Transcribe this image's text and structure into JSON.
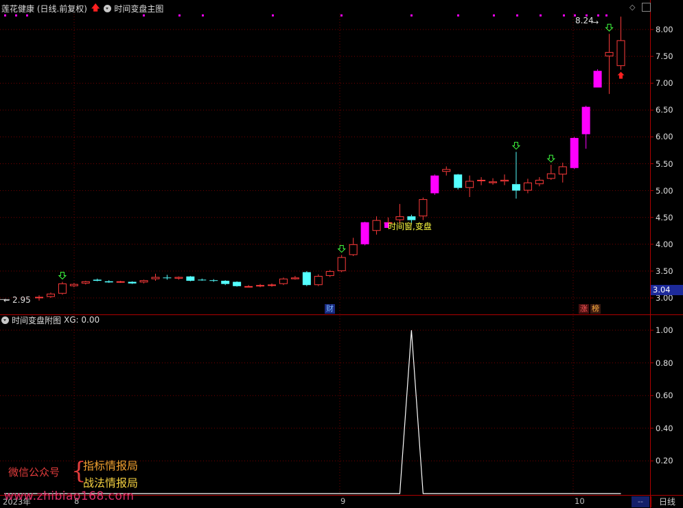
{
  "main_header": {
    "title": "莲花健康 (日线.前复权)",
    "indicator": "时间变盘主图"
  },
  "sub_header": {
    "indicator": "时间变盘附图",
    "value_text": "XG: 0.00"
  },
  "price_axis_labels": [
    "8.00",
    "7.50",
    "7.00",
    "6.50",
    "6.00",
    "5.50",
    "5.00",
    "4.50",
    "4.00",
    "3.50",
    "3.00"
  ],
  "sub_axis_labels": [
    "1.00",
    "0.80",
    "0.60",
    "0.40",
    "0.20"
  ],
  "current_price_tag": "3.04",
  "annotations": {
    "high": "8.24",
    "low": "2.95",
    "signal": "时间窗,变盘",
    "cai": "财",
    "zhang": "涨",
    "bang": "榜"
  },
  "x_labels": {
    "year": "2023年",
    "m8": "8",
    "m9": "9",
    "m10": "10"
  },
  "bottom_controls": {
    "dash": "--",
    "period": "日线"
  },
  "watermark": {
    "wechat": "微信公众号",
    "brace": "{",
    "line1": "指标情报局",
    "line2": "战法情报局",
    "url": "www.zhibiao168.com"
  },
  "colors": {
    "up": "#ff3b3b",
    "down_cyan": "#54ffff",
    "strong_up": "#ff00ff",
    "grid": "#7a0000",
    "axis_border": "#b00000",
    "dots": "#ff00ff",
    "signal_text": "#ffff40",
    "sub_line": "#ffffff"
  },
  "chart_data": {
    "type": "candlestick",
    "series": [
      {
        "o": 3.0,
        "h": 3.05,
        "l": 2.95,
        "c": 3.02,
        "k": "up"
      },
      {
        "o": 3.02,
        "h": 3.1,
        "l": 3.0,
        "c": 3.08,
        "k": "up"
      },
      {
        "o": 3.08,
        "h": 3.3,
        "l": 3.06,
        "c": 3.27,
        "k": "up"
      },
      {
        "o": 3.22,
        "h": 3.28,
        "l": 3.2,
        "c": 3.26,
        "k": "up"
      },
      {
        "o": 3.27,
        "h": 3.32,
        "l": 3.25,
        "c": 3.31,
        "k": "up"
      },
      {
        "o": 3.32,
        "h": 3.36,
        "l": 3.31,
        "c": 3.34,
        "k": "dn"
      },
      {
        "o": 3.31,
        "h": 3.33,
        "l": 3.28,
        "c": 3.29,
        "k": "dn"
      },
      {
        "o": 3.29,
        "h": 3.32,
        "l": 3.28,
        "c": 3.31,
        "k": "up"
      },
      {
        "o": 3.3,
        "h": 3.31,
        "l": 3.26,
        "c": 3.27,
        "k": "dn"
      },
      {
        "o": 3.29,
        "h": 3.34,
        "l": 3.27,
        "c": 3.33,
        "k": "up"
      },
      {
        "o": 3.35,
        "h": 3.45,
        "l": 3.32,
        "c": 3.39,
        "k": "up"
      },
      {
        "o": 3.38,
        "h": 3.43,
        "l": 3.34,
        "c": 3.37,
        "k": "dn"
      },
      {
        "o": 3.36,
        "h": 3.4,
        "l": 3.34,
        "c": 3.39,
        "k": "up"
      },
      {
        "o": 3.4,
        "h": 3.41,
        "l": 3.31,
        "c": 3.32,
        "k": "dn"
      },
      {
        "o": 3.34,
        "h": 3.36,
        "l": 3.32,
        "c": 3.33,
        "k": "dn"
      },
      {
        "o": 3.33,
        "h": 3.35,
        "l": 3.3,
        "c": 3.32,
        "k": "dn"
      },
      {
        "o": 3.32,
        "h": 3.33,
        "l": 3.24,
        "c": 3.26,
        "k": "dn"
      },
      {
        "o": 3.3,
        "h": 3.31,
        "l": 3.21,
        "c": 3.22,
        "k": "dn"
      },
      {
        "o": 3.22,
        "h": 3.24,
        "l": 3.2,
        "c": 3.22,
        "k": "up"
      },
      {
        "o": 3.22,
        "h": 3.26,
        "l": 3.2,
        "c": 3.24,
        "k": "up"
      },
      {
        "o": 3.24,
        "h": 3.27,
        "l": 3.21,
        "c": 3.25,
        "k": "up"
      },
      {
        "o": 3.26,
        "h": 3.38,
        "l": 3.24,
        "c": 3.36,
        "k": "up"
      },
      {
        "o": 3.35,
        "h": 3.41,
        "l": 3.34,
        "c": 3.38,
        "k": "up"
      },
      {
        "o": 3.48,
        "h": 3.5,
        "l": 3.22,
        "c": 3.24,
        "k": "dn"
      },
      {
        "o": 3.24,
        "h": 3.44,
        "l": 3.22,
        "c": 3.41,
        "k": "up"
      },
      {
        "o": 3.41,
        "h": 3.52,
        "l": 3.39,
        "c": 3.5,
        "k": "up"
      },
      {
        "o": 3.5,
        "h": 3.8,
        "l": 3.48,
        "c": 3.76,
        "k": "up"
      },
      {
        "o": 3.8,
        "h": 4.12,
        "l": 3.78,
        "c": 4.0,
        "k": "up"
      },
      {
        "o": 4.0,
        "h": 4.42,
        "l": 3.98,
        "c": 4.41,
        "k": "su"
      },
      {
        "o": 4.25,
        "h": 4.52,
        "l": 4.18,
        "c": 4.45,
        "k": "up"
      },
      {
        "o": 4.4,
        "h": 4.5,
        "l": 4.35,
        "c": 4.41,
        "k": "up"
      },
      {
        "o": 4.45,
        "h": 4.75,
        "l": 4.38,
        "c": 4.52,
        "k": "up"
      },
      {
        "o": 4.52,
        "h": 4.55,
        "l": 4.4,
        "c": 4.45,
        "k": "dn"
      },
      {
        "o": 4.52,
        "h": 4.87,
        "l": 4.45,
        "c": 4.84,
        "k": "up"
      },
      {
        "o": 4.95,
        "h": 5.3,
        "l": 4.92,
        "c": 5.28,
        "k": "su"
      },
      {
        "o": 5.35,
        "h": 5.45,
        "l": 5.28,
        "c": 5.4,
        "k": "up"
      },
      {
        "o": 5.3,
        "h": 5.31,
        "l": 5.02,
        "c": 5.05,
        "k": "dn"
      },
      {
        "o": 5.05,
        "h": 5.28,
        "l": 4.88,
        "c": 5.18,
        "k": "up"
      },
      {
        "o": 5.18,
        "h": 5.25,
        "l": 5.1,
        "c": 5.2,
        "k": "up"
      },
      {
        "o": 5.14,
        "h": 5.23,
        "l": 5.11,
        "c": 5.17,
        "k": "up"
      },
      {
        "o": 5.17,
        "h": 5.3,
        "l": 5.1,
        "c": 5.2,
        "k": "up"
      },
      {
        "o": 5.12,
        "h": 5.72,
        "l": 4.85,
        "c": 5.0,
        "k": "dn"
      },
      {
        "o": 5.0,
        "h": 5.22,
        "l": 4.95,
        "c": 5.15,
        "k": "up"
      },
      {
        "o": 5.12,
        "h": 5.25,
        "l": 5.08,
        "c": 5.2,
        "k": "up"
      },
      {
        "o": 5.22,
        "h": 5.48,
        "l": 5.2,
        "c": 5.32,
        "k": "up"
      },
      {
        "o": 5.3,
        "h": 5.52,
        "l": 5.15,
        "c": 5.45,
        "k": "up"
      },
      {
        "o": 5.42,
        "h": 6.0,
        "l": 5.4,
        "c": 5.98,
        "k": "su"
      },
      {
        "o": 6.05,
        "h": 6.58,
        "l": 5.78,
        "c": 6.56,
        "k": "su"
      },
      {
        "o": 6.92,
        "h": 7.26,
        "l": 6.92,
        "c": 7.23,
        "k": "su"
      },
      {
        "o": 7.5,
        "h": 7.92,
        "l": 6.8,
        "c": 7.58,
        "k": "up"
      },
      {
        "o": 7.32,
        "h": 8.24,
        "l": 7.25,
        "c": 7.8,
        "k": "up"
      }
    ],
    "down_arrow_marks_at": [
      2,
      26,
      41,
      44,
      49
    ],
    "up_arrow_mark_at": 50,
    "sub_series": {
      "name": "XG",
      "values": [
        0,
        0,
        0,
        0,
        0,
        0,
        0,
        0,
        0,
        0,
        0,
        0,
        0,
        0,
        0,
        0,
        0,
        0,
        0,
        0,
        0,
        0,
        0,
        0,
        0,
        0,
        0,
        0,
        0,
        0,
        0,
        0,
        1,
        0,
        0,
        0,
        0,
        0,
        0,
        0,
        0,
        0,
        0,
        0,
        0,
        0,
        0,
        0,
        0,
        0,
        0
      ]
    },
    "price_range": [
      2.85,
      8.5
    ],
    "sub_range": [
      0,
      1.05
    ]
  }
}
